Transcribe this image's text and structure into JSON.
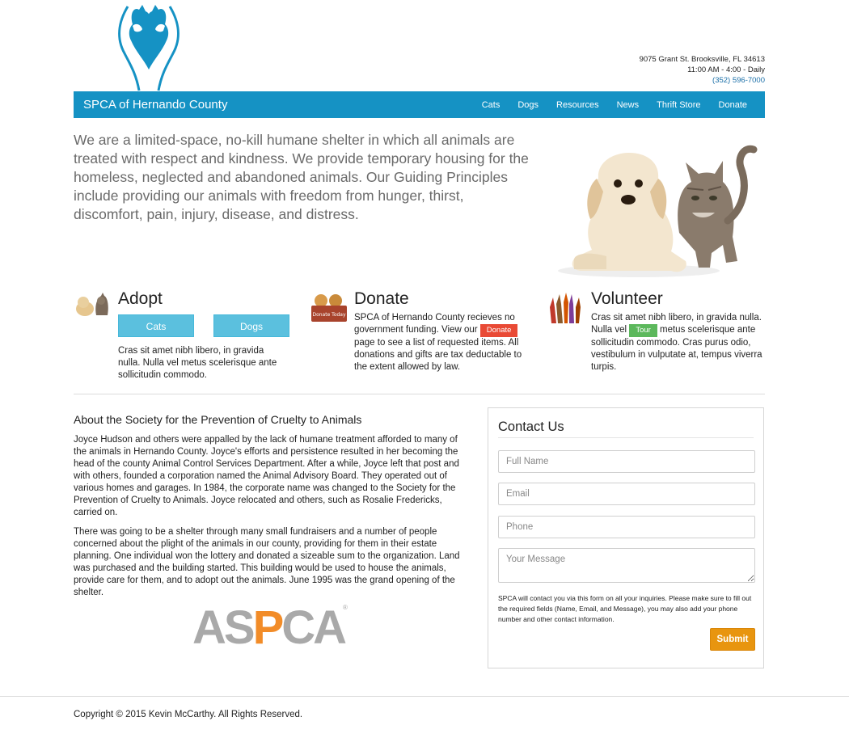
{
  "header": {
    "address": "9075 Grant St. Brooksville, FL 34613",
    "hours": "11:00 AM - 4:00 - Daily",
    "phone": "(352) 596-7000"
  },
  "nav": {
    "brand": "SPCA of Hernando County",
    "items": [
      "Cats",
      "Dogs",
      "Resources",
      "News",
      "Thrift Store",
      "Donate"
    ]
  },
  "intro": "We are a limited-space, no-kill humane shelter in which all animals are treated with respect and kindness. We provide temporary housing for the homeless, neglected and abandoned animals. Our Guiding Principles include providing our animals with freedom from hunger, thirst, discomfort, pain, injury, disease, and distress.",
  "adopt": {
    "title": "Adopt",
    "cats_button": "Cats",
    "dogs_button": "Dogs",
    "text": "Cras sit amet nibh libero, in gravida nulla. Nulla vel metus scelerisque ante sollicitudin commodo."
  },
  "donate": {
    "title": "Donate",
    "text_before": "SPCA of Hernando County recieves no government funding. View our",
    "button": "Donate",
    "text_after": "page to see a list of requested items. All donations and gifts are tax deductable to the extent allowed by law.",
    "sign_text": "Donate Today"
  },
  "volunteer": {
    "title": "Volunteer",
    "text_before": "Cras sit amet nibh libero, in gravida nulla. Nulla vel",
    "button": "Tour",
    "text_after": "metus scelerisque ante sollicitudin commodo. Cras purus odio, vestibulum in vulputate at, tempus viverra turpis."
  },
  "about": {
    "title": "About the Society for the Prevention of Cruelty to Animals",
    "p1": "Joyce Hudson and others were appalled by the lack of humane treatment afforded to many of the animals in Hernando County. Joyce's efforts and persistence resulted in her becoming the head of the county Animal Control Services Department. After a while, Joyce left that post and with others, founded a corporation named the Animal Advisory Board. They operated out of various homes and garages. In 1984, the corporate name was changed to the Society for the Prevention of Cruelty to Animals. Joyce relocated and others, such as Rosalie Fredericks, carried on.",
    "p2": "There was going to be a shelter through many small fundraisers and a number of people concerned about the plight of the animals in our county, providing for them in their estate planning. One individual won the lottery and donated a sizeable sum to the organization. Land was purchased and the building started. This building would be used to house the animals, provide care for them, and to adopt out the animals. June 1995 was the grand opening of the shelter.",
    "logo_text": "ASPCA"
  },
  "contact": {
    "title": "Contact Us",
    "full_name_placeholder": "Full Name",
    "email_placeholder": "Email",
    "phone_placeholder": "Phone",
    "message_placeholder": "Your Message",
    "note": "SPCA will contact you via this form on all your inquiries. Please make sure to fill out the required fields (Name, Email, and Message), you may also add your phone number and other contact information.",
    "submit": "Submit"
  },
  "footer": {
    "copyright": "Copyright © 2015 Kevin McCarthy. All Rights Reserved."
  },
  "colors": {
    "nav_bg": "#1592c4",
    "adopt_button": "#5bc0de",
    "donate_button": "#e94a35",
    "tour_button": "#5cb85c",
    "submit_button": "#e8950f"
  }
}
